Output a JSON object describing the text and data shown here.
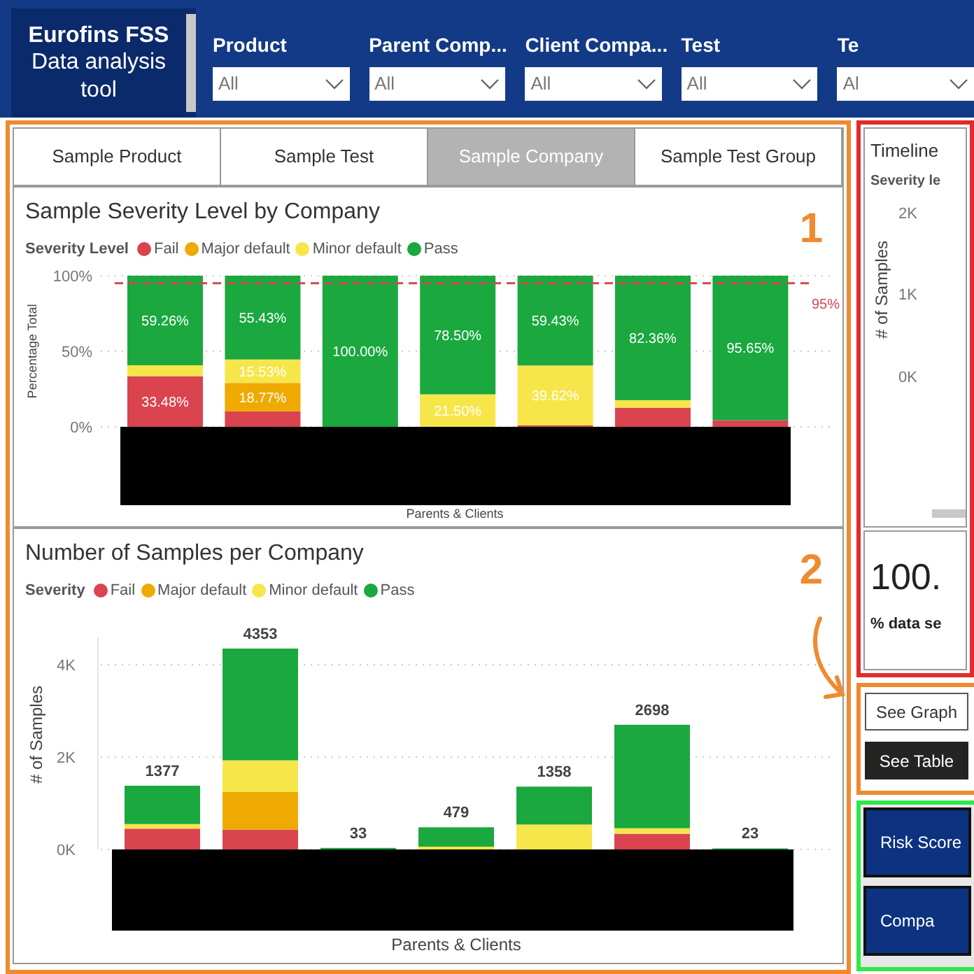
{
  "logo": {
    "title": "Eurofins FSS",
    "subtitle": "Data analysis tool"
  },
  "filters": [
    {
      "label": "Product",
      "value": "All"
    },
    {
      "label": "Parent Comp...",
      "value": "All"
    },
    {
      "label": "Client Compa...",
      "value": "All"
    },
    {
      "label": "Test",
      "value": "All"
    },
    {
      "label": "Te",
      "value": "Al"
    }
  ],
  "tabs": [
    {
      "label": "Sample Product",
      "selected": false
    },
    {
      "label": "Sample Test",
      "selected": false
    },
    {
      "label": "Sample Company",
      "selected": true
    },
    {
      "label": "Sample Test Group",
      "selected": false
    }
  ],
  "severity_chart": {
    "callout": "1",
    "legend_title": "Severity Level",
    "chart_data": {
      "type": "bar",
      "stacked": true,
      "title": "Sample Severity Level by Company",
      "xlabel": "Parents & Clients",
      "ylabel": "Percentage Total",
      "ylim": [
        0,
        100
      ],
      "yticks": [
        {
          "value": 0,
          "label": "0%"
        },
        {
          "value": 50,
          "label": "50%"
        },
        {
          "value": 100,
          "label": "100%"
        }
      ],
      "series": [
        {
          "name": "Fail",
          "color": "#d9444f",
          "values": [
            33.48,
            10.27,
            0,
            0,
            0.95,
            12.64,
            4.35
          ],
          "value_labels": [
            "33.48%",
            null,
            null,
            null,
            null,
            null,
            null
          ]
        },
        {
          "name": "Major default",
          "color": "#eeaa00",
          "values": [
            0,
            18.77,
            0,
            0,
            0,
            0,
            0
          ],
          "value_labels": [
            null,
            "18.77%",
            null,
            null,
            null,
            null,
            null
          ]
        },
        {
          "name": "Minor default",
          "color": "#f7e64a",
          "values": [
            7.26,
            15.53,
            0,
            21.5,
            39.62,
            5,
            0
          ],
          "value_labels": [
            null,
            "15.53%",
            null,
            "21.50%",
            "39.62%",
            null,
            null
          ]
        },
        {
          "name": "Pass",
          "color": "#1aa83f",
          "values": [
            59.26,
            55.43,
            100,
            78.5,
            59.43,
            82.36,
            95.65
          ],
          "value_labels": [
            "59.26%",
            "55.43%",
            "100.00%",
            "78.50%",
            "59.43%",
            "82.36%",
            "95.65%"
          ]
        }
      ],
      "ref_lines": [
        {
          "axis": "y",
          "value": 95,
          "label": "95%",
          "color": "#d9444f"
        }
      ]
    }
  },
  "samples_chart": {
    "callout": "2",
    "legend_title": "Severity",
    "totals": [
      "1377",
      "4353",
      "33",
      "479",
      "1358",
      "2698",
      "23"
    ],
    "chart_data": {
      "type": "bar",
      "stacked": true,
      "title": "Number of Samples per Company",
      "xlabel": "Parents & Clients",
      "ylabel": "# of Samples",
      "ylim": [
        0,
        4600
      ],
      "yticks": [
        {
          "value": 0,
          "label": "0K"
        },
        {
          "value": 2000,
          "label": "2K"
        },
        {
          "value": 4000,
          "label": "4K"
        }
      ],
      "series": [
        {
          "name": "Fail",
          "color": "#d9444f",
          "values": [
            450,
            430,
            0,
            0,
            0,
            340,
            0
          ]
        },
        {
          "name": "Major default",
          "color": "#eeaa00",
          "values": [
            0,
            820,
            0,
            0,
            0,
            0,
            0
          ]
        },
        {
          "name": "Minor default",
          "color": "#f7e64a",
          "values": [
            100,
            680,
            0,
            60,
            540,
            120,
            0
          ]
        },
        {
          "name": "Pass",
          "color": "#1aa83f",
          "values": [
            830,
            2420,
            33,
            420,
            820,
            2240,
            23
          ]
        }
      ]
    }
  },
  "timeline": {
    "title": "Timeline",
    "legend_title": "Severity le",
    "ylabel": "# of Samples",
    "yticks": [
      "2K",
      "1K",
      "0K"
    ]
  },
  "kpi": {
    "value": "100.",
    "label": "% data se"
  },
  "view_buttons": [
    {
      "label": "See Graph",
      "selected": false
    },
    {
      "label": "See Table",
      "selected": true
    }
  ],
  "nav_buttons": [
    {
      "label": "Risk Score"
    },
    {
      "label": "Compa"
    }
  ]
}
